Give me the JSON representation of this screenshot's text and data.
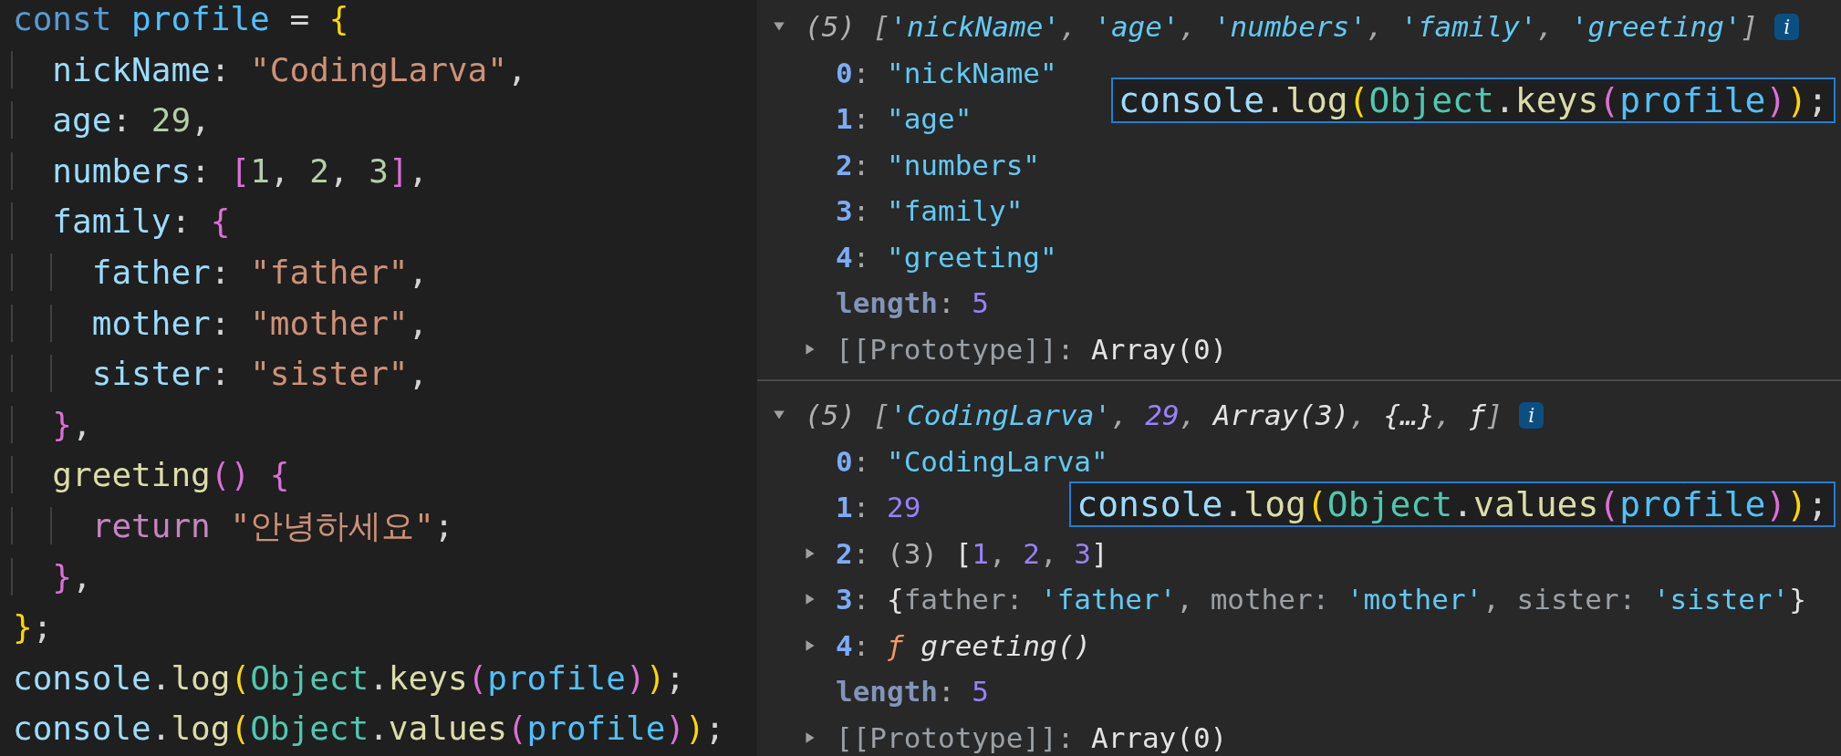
{
  "editor": {
    "lines": [
      [
        {
          "t": "const",
          "kind": "kw"
        },
        {
          "t": " profile",
          "kind": "var"
        },
        {
          "t": " = ",
          "kind": "p"
        },
        {
          "t": "{",
          "kind": "b1"
        }
      ],
      [
        {
          "t": "  nickName",
          "kind": "prop"
        },
        {
          "t": ": ",
          "kind": "p"
        },
        {
          "t": "\"CodingLarva\"",
          "kind": "str"
        },
        {
          "t": ",",
          "kind": "p"
        }
      ],
      [
        {
          "t": "  age",
          "kind": "prop"
        },
        {
          "t": ": ",
          "kind": "p"
        },
        {
          "t": "29",
          "kind": "num"
        },
        {
          "t": ",",
          "kind": "p"
        }
      ],
      [
        {
          "t": "  numbers",
          "kind": "prop"
        },
        {
          "t": ": ",
          "kind": "p"
        },
        {
          "t": "[",
          "kind": "b2"
        },
        {
          "t": "1",
          "kind": "num"
        },
        {
          "t": ", ",
          "kind": "p"
        },
        {
          "t": "2",
          "kind": "num"
        },
        {
          "t": ", ",
          "kind": "p"
        },
        {
          "t": "3",
          "kind": "num"
        },
        {
          "t": "]",
          "kind": "b2"
        },
        {
          "t": ",",
          "kind": "p"
        }
      ],
      [
        {
          "t": "  family",
          "kind": "prop"
        },
        {
          "t": ": ",
          "kind": "p"
        },
        {
          "t": "{",
          "kind": "b2"
        }
      ],
      [
        {
          "t": "    father",
          "kind": "prop"
        },
        {
          "t": ": ",
          "kind": "p"
        },
        {
          "t": "\"father\"",
          "kind": "str"
        },
        {
          "t": ",",
          "kind": "p"
        }
      ],
      [
        {
          "t": "    mother",
          "kind": "prop"
        },
        {
          "t": ": ",
          "kind": "p"
        },
        {
          "t": "\"mother\"",
          "kind": "str"
        },
        {
          "t": ",",
          "kind": "p"
        }
      ],
      [
        {
          "t": "    sister",
          "kind": "prop"
        },
        {
          "t": ": ",
          "kind": "p"
        },
        {
          "t": "\"sister\"",
          "kind": "str"
        },
        {
          "t": ",",
          "kind": "p"
        }
      ],
      [
        {
          "t": "  }",
          "kind": "b2"
        },
        {
          "t": ",",
          "kind": "p"
        }
      ],
      [
        {
          "t": "  greeting",
          "kind": "fn"
        },
        {
          "t": "() {",
          "kind": "b2"
        }
      ],
      [
        {
          "t": "    return",
          "kind": "ctl"
        },
        {
          "t": " \"안녕하세요\"",
          "kind": "str"
        },
        {
          "t": ";",
          "kind": "p"
        }
      ],
      [
        {
          "t": "  }",
          "kind": "b2"
        },
        {
          "t": ",",
          "kind": "p"
        }
      ],
      [
        {
          "t": "}",
          "kind": "b1"
        },
        {
          "t": ";",
          "kind": "p"
        }
      ],
      [
        {
          "t": "console",
          "kind": "prop"
        },
        {
          "t": ".",
          "kind": "p"
        },
        {
          "t": "log",
          "kind": "fn"
        },
        {
          "t": "(",
          "kind": "b1"
        },
        {
          "t": "Object",
          "kind": "cls"
        },
        {
          "t": ".",
          "kind": "p"
        },
        {
          "t": "keys",
          "kind": "fn"
        },
        {
          "t": "(",
          "kind": "b2"
        },
        {
          "t": "profile",
          "kind": "var"
        },
        {
          "t": ")",
          "kind": "b2"
        },
        {
          "t": ")",
          "kind": "b1"
        },
        {
          "t": ";",
          "kind": "p"
        }
      ],
      [
        {
          "t": "console",
          "kind": "prop"
        },
        {
          "t": ".",
          "kind": "p"
        },
        {
          "t": "log",
          "kind": "fn"
        },
        {
          "t": "(",
          "kind": "b1"
        },
        {
          "t": "Object",
          "kind": "cls"
        },
        {
          "t": ".",
          "kind": "p"
        },
        {
          "t": "values",
          "kind": "fn"
        },
        {
          "t": "(",
          "kind": "b2"
        },
        {
          "t": "profile",
          "kind": "var"
        },
        {
          "t": ")",
          "kind": "b2"
        },
        {
          "t": ")",
          "kind": "b1"
        },
        {
          "t": ";",
          "kind": "p"
        }
      ]
    ]
  },
  "console": {
    "groups": [
      {
        "expanded": true,
        "badge": "i",
        "tokens": [
          {
            "t": "(5) ",
            "kind": "cnt"
          },
          {
            "t": "[",
            "kind": "p"
          },
          {
            "t": "'nickName'",
            "kind": "s"
          },
          {
            "t": ", ",
            "kind": "p"
          },
          {
            "t": "'age'",
            "kind": "s"
          },
          {
            "t": ", ",
            "kind": "p"
          },
          {
            "t": "'numbers'",
            "kind": "s"
          },
          {
            "t": ", ",
            "kind": "p"
          },
          {
            "t": "'family'",
            "kind": "s"
          },
          {
            "t": ", ",
            "kind": "p"
          },
          {
            "t": "'greeting'",
            "kind": "s"
          },
          {
            "t": "]",
            "kind": "p"
          }
        ],
        "children": [
          {
            "kind": "leaf",
            "tokens": [
              {
                "t": "0",
                "kind": "idx"
              },
              {
                "t": ": ",
                "kind": "p"
              },
              {
                "t": "\"nickName\"",
                "kind": "s"
              }
            ]
          },
          {
            "kind": "leaf",
            "tokens": [
              {
                "t": "1",
                "kind": "idx"
              },
              {
                "t": ": ",
                "kind": "p"
              },
              {
                "t": "\"age\"",
                "kind": "s"
              }
            ]
          },
          {
            "kind": "leaf",
            "tokens": [
              {
                "t": "2",
                "kind": "idx"
              },
              {
                "t": ": ",
                "kind": "p"
              },
              {
                "t": "\"numbers\"",
                "kind": "s"
              }
            ]
          },
          {
            "kind": "leaf",
            "tokens": [
              {
                "t": "3",
                "kind": "idx"
              },
              {
                "t": ": ",
                "kind": "p"
              },
              {
                "t": "\"family\"",
                "kind": "s"
              }
            ]
          },
          {
            "kind": "leaf",
            "tokens": [
              {
                "t": "4",
                "kind": "idx"
              },
              {
                "t": ": ",
                "kind": "p"
              },
              {
                "t": "\"greeting\"",
                "kind": "s"
              }
            ]
          },
          {
            "kind": "leaf",
            "tokens": [
              {
                "t": "length",
                "kind": "meta"
              },
              {
                "t": ": ",
                "kind": "p"
              },
              {
                "t": "5",
                "kind": "n"
              }
            ]
          },
          {
            "kind": "node",
            "expanded": false,
            "tokens": [
              {
                "t": "[[Prototype]]",
                "kind": "dim"
              },
              {
                "t": ": ",
                "kind": "p"
              },
              {
                "t": "Array(0)",
                "kind": "w"
              }
            ]
          }
        ],
        "callout": [
          {
            "t": "console",
            "kind": "prop"
          },
          {
            "t": ".",
            "kind": "p"
          },
          {
            "t": "log",
            "kind": "fn"
          },
          {
            "t": "(",
            "kind": "b1"
          },
          {
            "t": "Object",
            "kind": "cls"
          },
          {
            "t": ".",
            "kind": "p"
          },
          {
            "t": "keys",
            "kind": "fn"
          },
          {
            "t": "(",
            "kind": "b2"
          },
          {
            "t": "profile",
            "kind": "var"
          },
          {
            "t": ")",
            "kind": "b2"
          },
          {
            "t": ")",
            "kind": "b1"
          },
          {
            "t": ";",
            "kind": "p"
          }
        ]
      },
      {
        "expanded": true,
        "badge": "i",
        "tokens": [
          {
            "t": "(5) ",
            "kind": "cnt"
          },
          {
            "t": "[",
            "kind": "p"
          },
          {
            "t": "'CodingLarva'",
            "kind": "s"
          },
          {
            "t": ", ",
            "kind": "p"
          },
          {
            "t": "29",
            "kind": "n"
          },
          {
            "t": ", ",
            "kind": "p"
          },
          {
            "t": "Array(3)",
            "kind": "w"
          },
          {
            "t": ", ",
            "kind": "p"
          },
          {
            "t": "{…}",
            "kind": "w"
          },
          {
            "t": ", ",
            "kind": "p"
          },
          {
            "t": "ƒ",
            "kind": "w"
          },
          {
            "t": "]",
            "kind": "p"
          }
        ],
        "children": [
          {
            "kind": "leaf",
            "tokens": [
              {
                "t": "0",
                "kind": "idx"
              },
              {
                "t": ": ",
                "kind": "p"
              },
              {
                "t": "\"CodingLarva\"",
                "kind": "s"
              }
            ]
          },
          {
            "kind": "leaf",
            "tokens": [
              {
                "t": "1",
                "kind": "idx"
              },
              {
                "t": ": ",
                "kind": "p"
              },
              {
                "t": "29",
                "kind": "n"
              }
            ]
          },
          {
            "kind": "node",
            "expanded": false,
            "tokens": [
              {
                "t": "2",
                "kind": "idx"
              },
              {
                "t": ": ",
                "kind": "p"
              },
              {
                "t": "(3) ",
                "kind": "cnt"
              },
              {
                "t": "[",
                "kind": "w"
              },
              {
                "t": "1",
                "kind": "n"
              },
              {
                "t": ", ",
                "kind": "p"
              },
              {
                "t": "2",
                "kind": "n"
              },
              {
                "t": ", ",
                "kind": "p"
              },
              {
                "t": "3",
                "kind": "n"
              },
              {
                "t": "]",
                "kind": "w"
              }
            ]
          },
          {
            "kind": "node",
            "expanded": false,
            "tokens": [
              {
                "t": "3",
                "kind": "idx"
              },
              {
                "t": ": ",
                "kind": "p"
              },
              {
                "t": "{",
                "kind": "w"
              },
              {
                "t": "father: ",
                "kind": "dim"
              },
              {
                "t": "'father'",
                "kind": "s"
              },
              {
                "t": ", ",
                "kind": "p"
              },
              {
                "t": "mother: ",
                "kind": "dim"
              },
              {
                "t": "'mother'",
                "kind": "s"
              },
              {
                "t": ", ",
                "kind": "p"
              },
              {
                "t": "sister: ",
                "kind": "dim"
              },
              {
                "t": "'sister'",
                "kind": "s"
              },
              {
                "t": "}",
                "kind": "w"
              }
            ]
          },
          {
            "kind": "node",
            "expanded": false,
            "tokens": [
              {
                "t": "4",
                "kind": "idx"
              },
              {
                "t": ": ",
                "kind": "p"
              },
              {
                "t": "ƒ ",
                "kind": "fnmark"
              },
              {
                "t": "greeting()",
                "kind": "fnname"
              }
            ]
          },
          {
            "kind": "leaf",
            "tokens": [
              {
                "t": "length",
                "kind": "meta"
              },
              {
                "t": ": ",
                "kind": "p"
              },
              {
                "t": "5",
                "kind": "n"
              }
            ]
          },
          {
            "kind": "node",
            "expanded": false,
            "tokens": [
              {
                "t": "[[Prototype]]",
                "kind": "dim"
              },
              {
                "t": ": ",
                "kind": "p"
              },
              {
                "t": "Array(0)",
                "kind": "w"
              }
            ]
          }
        ],
        "callout": [
          {
            "t": "console",
            "kind": "prop"
          },
          {
            "t": ".",
            "kind": "p"
          },
          {
            "t": "log",
            "kind": "fn"
          },
          {
            "t": "(",
            "kind": "b1"
          },
          {
            "t": "Object",
            "kind": "cls"
          },
          {
            "t": ".",
            "kind": "p"
          },
          {
            "t": "values",
            "kind": "fn"
          },
          {
            "t": "(",
            "kind": "b2"
          },
          {
            "t": "profile",
            "kind": "var"
          },
          {
            "t": ")",
            "kind": "b2"
          },
          {
            "t": ")",
            "kind": "b1"
          },
          {
            "t": ";",
            "kind": "p"
          }
        ]
      }
    ]
  }
}
